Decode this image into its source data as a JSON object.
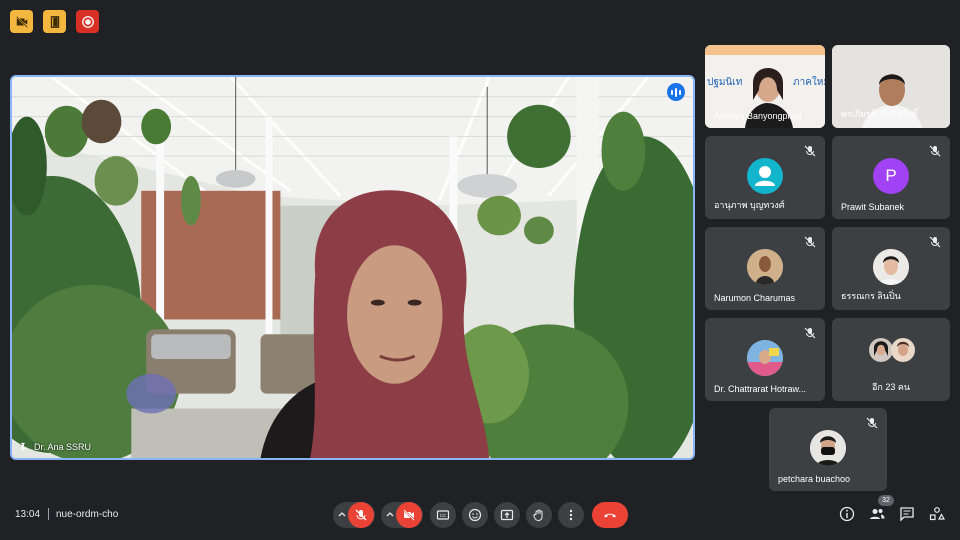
{
  "top_bar": {
    "icons": [
      "no-camera-icon",
      "door-icon",
      "record-icon"
    ]
  },
  "main_stage": {
    "speaker_name": "Dr. Ana SSRU",
    "speaking_indicator": "audio-level-icon",
    "pin_icon": "pin-icon"
  },
  "participants": [
    {
      "name": "Ananya Banyongpisut",
      "type": "video",
      "slide_text": "ปฐมนิเทศ ...ภาคใหม่"
    },
    {
      "name": "พรเกียรติ ภักดีสวัสดิ์",
      "type": "video"
    },
    {
      "name": "อานุภาพ บุญทวงศ์",
      "type": "avatar",
      "muted": true
    },
    {
      "name": "Prawit Subanek",
      "type": "avatar",
      "initial": "P",
      "muted": true
    },
    {
      "name": "Narumon Charumas",
      "type": "avatar",
      "muted": true
    },
    {
      "name": "ธรรณกร ลินปิ่น",
      "type": "avatar",
      "muted": true
    },
    {
      "name": "Dr. Chattrarat Hotraw...",
      "type": "avatar",
      "muted": true
    },
    {
      "name": "อีก 23 คน",
      "type": "group"
    },
    {
      "name": "petchara buachoo",
      "type": "avatar",
      "muted": true
    }
  ],
  "bottom_bar": {
    "time": "13:04",
    "meeting_code": "nue-ordm-cho",
    "people_count": "32"
  },
  "colors": {
    "background": "#202124",
    "tile": "#3c4043",
    "active_border": "#8ab4f8",
    "danger": "#ea4335",
    "warning": "#f3b73f"
  }
}
